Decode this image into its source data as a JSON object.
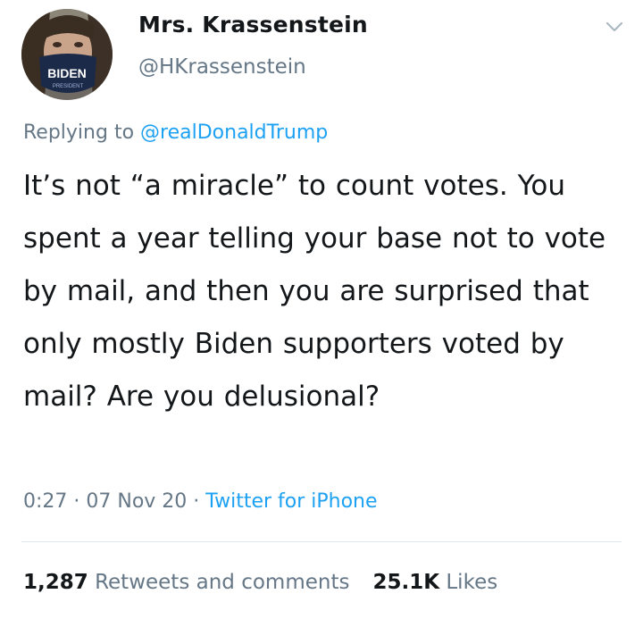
{
  "author": {
    "display_name": "Mrs. Krassenstein",
    "handle": "@HKrassenstein",
    "mask_text": "BIDEN",
    "mask_subtext": "PRESIDENT"
  },
  "reply": {
    "prefix": "Replying to",
    "mention": "@realDonaldTrump"
  },
  "tweet_text": "It’s not “a miracle” to count votes. You spent a year telling your base not to vote by mail, and then you are surprised that only mostly Biden supporters voted by mail?  Are you delusional?",
  "meta": {
    "time": "0:27",
    "sep1": " · ",
    "date": "07 Nov 20",
    "sep2": " · ",
    "source": "Twitter for iPhone"
  },
  "stats": {
    "retweets_count": "1,287",
    "retweets_label": "Retweets and comments",
    "likes_count": "25.1K",
    "likes_label": "Likes"
  },
  "colors": {
    "link_blue": "#1da1f2",
    "secondary_gray": "#657786",
    "divider": "#e1e8ed",
    "mask_navy": "#1c2a4a"
  },
  "icons": {
    "chevron": "chevron-down-icon"
  }
}
